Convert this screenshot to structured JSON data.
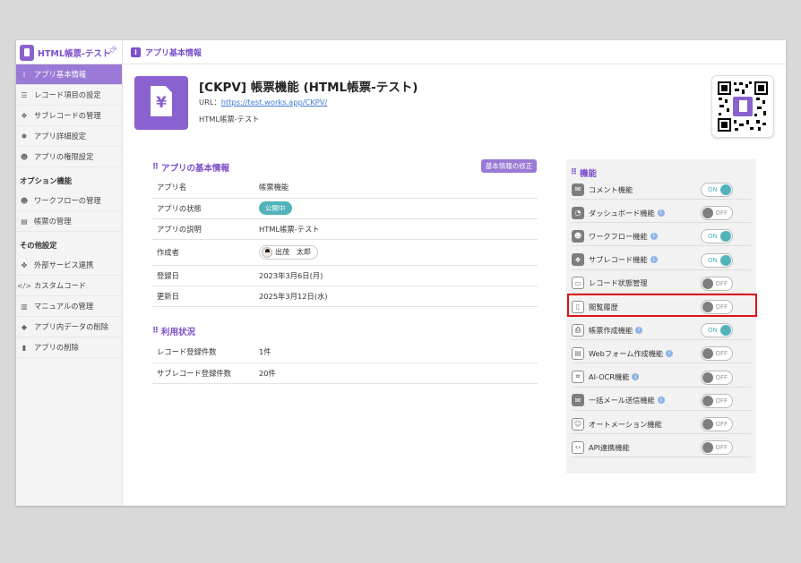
{
  "header": {
    "app_name": "HTML帳票-テスト",
    "breadcrumb": "アプリ基本情報",
    "breadcrumb_icon": "i"
  },
  "sidebar": {
    "items": [
      {
        "label": "アプリ基本情報",
        "icon": "info-icon",
        "glyph": "i",
        "active": true
      },
      {
        "label": "レコード項目の設定",
        "icon": "list-icon",
        "glyph": "☰"
      },
      {
        "label": "サブレコードの管理",
        "icon": "layers-icon",
        "glyph": "❖"
      },
      {
        "label": "アプリ詳細設定",
        "icon": "gear-icon",
        "glyph": "✱"
      },
      {
        "label": "アプリの権限設定",
        "icon": "users-icon",
        "glyph": "☻"
      }
    ],
    "option_heading": "オプション機能",
    "option_items": [
      {
        "label": "ワークフローの管理",
        "icon": "workflow-icon",
        "glyph": "☻"
      },
      {
        "label": "帳票の管理",
        "icon": "document-icon",
        "glyph": "▤"
      }
    ],
    "other_heading": "その他設定",
    "other_items": [
      {
        "label": "外部サービス連携",
        "icon": "puzzle-icon",
        "glyph": "✤"
      },
      {
        "label": "カスタムコード",
        "icon": "code-icon",
        "glyph": "</>"
      },
      {
        "label": "マニュアルの管理",
        "icon": "book-icon",
        "glyph": "▥"
      },
      {
        "label": "アプリ内データの削除",
        "icon": "eraser-icon",
        "glyph": "◆"
      },
      {
        "label": "アプリの削除",
        "icon": "trash-icon",
        "glyph": "▮"
      }
    ]
  },
  "app": {
    "title": "[CKPV] 帳票機能 (HTML帳票-テスト)",
    "url_label": "URL：",
    "url": "https://test.works.app/CKPV/",
    "description": "HTML帳票-テスト"
  },
  "basic": {
    "title": "アプリの基本情報",
    "edit_label": "基本情報の修正",
    "rows": [
      {
        "key": "アプリ名",
        "value": "帳票機能"
      },
      {
        "key": "アプリの状態",
        "value": "公開中"
      },
      {
        "key": "アプリの説明",
        "value": "HTML帳票-テスト"
      },
      {
        "key": "作成者",
        "value": "出茂　太郎"
      },
      {
        "key": "登録日",
        "value": "2023年3月6日(月)"
      },
      {
        "key": "更新日",
        "value": "2025年3月12日(水)"
      }
    ]
  },
  "usage": {
    "title": "利用状況",
    "rows": [
      {
        "key": "レコード登録件数",
        "value": "1件"
      },
      {
        "key": "サブレコード登録件数",
        "value": "20件"
      }
    ]
  },
  "features": {
    "title": "機能",
    "items": [
      {
        "name": "コメント機能",
        "icon": "comment-icon",
        "glyph": "✉",
        "state": "ON",
        "info": false
      },
      {
        "name": "ダッシュボード機能",
        "icon": "dashboard-icon",
        "glyph": "◔",
        "state": "OFF",
        "info": true
      },
      {
        "name": "ワークフロー機能",
        "icon": "workflow-icon",
        "glyph": "☻",
        "state": "ON",
        "info": true
      },
      {
        "name": "サブレコード機能",
        "icon": "layers-icon",
        "glyph": "❖",
        "state": "ON",
        "info": true
      },
      {
        "name": "レコード状態管理",
        "icon": "status-icon",
        "glyph": "▭",
        "state": "OFF",
        "info": false
      },
      {
        "name": "閲覧履歴",
        "icon": "history-icon",
        "glyph": "▯",
        "state": "OFF",
        "info": false
      },
      {
        "name": "帳票作成機能",
        "icon": "printer-icon",
        "glyph": "⎙",
        "state": "ON",
        "info": true
      },
      {
        "name": "Webフォーム作成機能",
        "icon": "form-icon",
        "glyph": "▤",
        "state": "OFF",
        "info": true
      },
      {
        "name": "AI-OCR機能",
        "icon": "scan-icon",
        "glyph": "⌗",
        "state": "OFF",
        "info": true
      },
      {
        "name": "一括メール送信機能",
        "icon": "mail-icon",
        "glyph": "✉",
        "state": "OFF",
        "info": true
      },
      {
        "name": "オートメーション機能",
        "icon": "robot-icon",
        "glyph": "☺",
        "state": "OFF",
        "info": false
      },
      {
        "name": "API連携機能",
        "icon": "api-icon",
        "glyph": "‹›",
        "state": "OFF",
        "info": false
      }
    ]
  },
  "colors": {
    "accent": "#7b4fcb",
    "accent_light": "#9a7ad6",
    "toggle_on": "#52b3b9",
    "highlight": "#e0101a"
  }
}
